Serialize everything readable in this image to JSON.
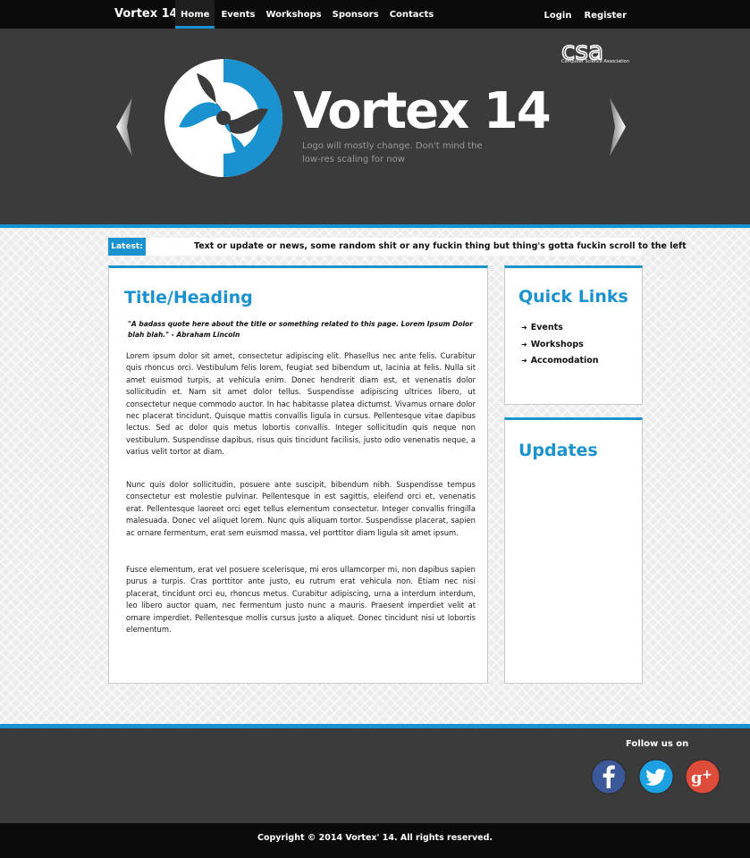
{
  "nav": {
    "brand": "Vortex 14",
    "items": [
      {
        "label": "Home",
        "active": true
      },
      {
        "label": "Events",
        "active": false
      },
      {
        "label": "Workshops",
        "active": false
      },
      {
        "label": "Sponsors",
        "active": false
      },
      {
        "label": "Contacts",
        "active": false
      }
    ],
    "auth": {
      "login": "Login",
      "register": "Register"
    }
  },
  "hero": {
    "title": "Vortex 14",
    "note": "Logo will mostly change. Don't mind the low-res scaling for now",
    "csa_logo_text": "csa",
    "csa_subtitle": "Computer Science Association"
  },
  "ticker": {
    "label": "Latest:",
    "text": "Text or update or news, some random shit or any fuckin thing but thing's gotta fuckin scroll to the left"
  },
  "main": {
    "heading": "Title/Heading",
    "quote": "\"A badass quote here about the title or something related to this page. Lorem Ipsum Dolor blah blah.\" - Abraham Lincoln",
    "paragraphs": [
      "Lorem ipsum dolor sit amet, consectetur adipiscing elit. Phasellus nec ante felis. Curabitur quis rhoncus orci. Vestibulum felis lorem, feugiat sed bibendum ut, lacinia at felis. Nulla sit amet euismod turpis, at vehicula enim. Donec hendrerit diam est, et venenatis dolor sollicitudin et. Nam sit amet dolor tellus. Suspendisse adipiscing ultrices libero, ut consectetur neque commodo auctor. In hac habitasse platea dictumst. Vivamus ornare dolor nec placerat tincidunt. Quisque mattis convallis ligula in cursus. Pellentesque vitae dapibus lectus. Sed ac dolor quis metus lobortis convallis. Integer sollicitudin quis neque non vestibulum. Suspendisse dapibus, risus quis tincidunt facilisis, justo odio venenatis neque, a varius velit tortor at diam.",
      "Nunc quis dolor sollicitudin, posuere ante suscipit, bibendum nibh. Suspendisse tempus consectetur est molestie pulvinar. Pellentesque in est sagittis, eleifend orci et, venenatis erat. Pellentesque laoreet orci eget tellus elementum consectetur. Integer convallis fringilla malesuada. Donec vel aliquet lorem. Nunc quis aliquam tortor. Suspendisse placerat, sapien ac ornare fermentum, erat sem euismod massa, vel porttitor diam ligula sit amet ipsum.",
      "Fusce elementum, erat vel posuere scelerisque, mi eros ullamcorper mi, non dapibus sapien purus a turpis. Cras porttitor ante justo, eu rutrum erat vehicula non. Etiam nec nisi placerat, tincidunt orci eu, rhoncus metus. Curabitur adipiscing, urna a interdum interdum, leo libero auctor quam, nec fermentum justo nunc a mauris. Praesent imperdiet velit at ornare imperdiet. Pellentesque mollis cursus justo a aliquet. Donec tincidunt nisi ut lobortis elementum."
    ]
  },
  "quick_links": {
    "heading": "Quick Links",
    "items": [
      "Events",
      "Workshops",
      "Accomodation"
    ]
  },
  "updates": {
    "heading": "Updates"
  },
  "footer": {
    "follow": "Follow us on",
    "social": [
      "facebook-icon",
      "twitter-icon",
      "google-plus-icon"
    ],
    "copyright": "Copyright © 2014 Vortex' 14. All rights reserved."
  },
  "colors": {
    "accent": "#1a92d0",
    "dark": "#3b3b3b",
    "black": "#0b0b0b",
    "facebook": "#3b5998",
    "twitter": "#1da1e2",
    "google_plus": "#dd4b39"
  }
}
